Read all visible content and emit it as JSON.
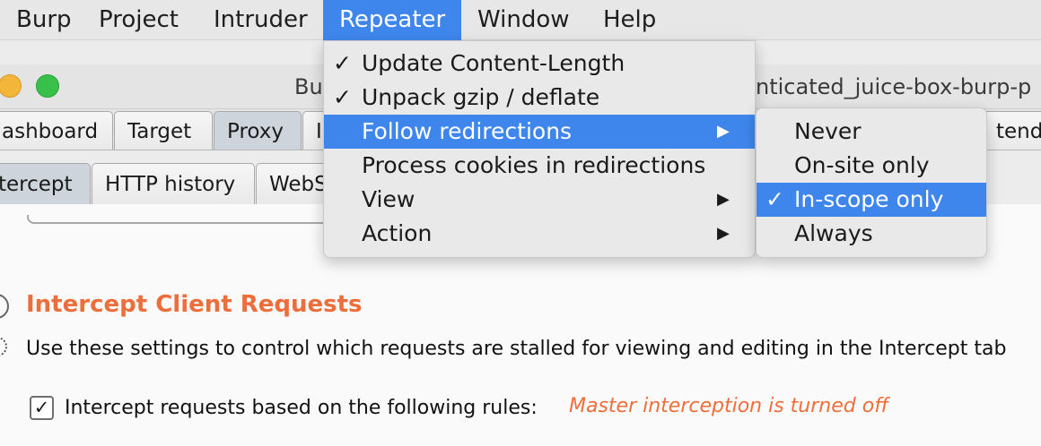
{
  "menubar": {
    "items": [
      "Burp",
      "Project",
      "Intruder",
      "Repeater",
      "Window",
      "Help"
    ],
    "active_index": 3
  },
  "window": {
    "title_left": "Bu",
    "title_right": "nticated_juice-box-burp-p"
  },
  "tabs": {
    "main": [
      "ashboard",
      "Target",
      "Proxy",
      "I",
      "tende"
    ],
    "selected_main": "Proxy",
    "sub": [
      "tercept",
      "HTTP history",
      "WebS"
    ]
  },
  "repeater_menu": {
    "items": [
      {
        "label": "Update Content-Length",
        "checked": true,
        "submenu": false,
        "highlighted": false
      },
      {
        "label": "Unpack gzip / deflate",
        "checked": true,
        "submenu": false,
        "highlighted": false
      },
      {
        "label": "Follow redirections",
        "checked": false,
        "submenu": true,
        "highlighted": true
      },
      {
        "label": "Process cookies in redirections",
        "checked": false,
        "submenu": false,
        "highlighted": false
      },
      {
        "label": "View",
        "checked": false,
        "submenu": true,
        "highlighted": false
      },
      {
        "label": "Action",
        "checked": false,
        "submenu": true,
        "highlighted": false
      }
    ],
    "check_glyph": "✓",
    "arrow_glyph": "▶"
  },
  "redirect_submenu": {
    "items": [
      {
        "label": "Never",
        "checked": false,
        "highlighted": false
      },
      {
        "label": "On-site only",
        "checked": false,
        "highlighted": false
      },
      {
        "label": "In-scope only",
        "checked": true,
        "highlighted": true
      },
      {
        "label": "Always",
        "checked": false,
        "highlighted": false
      }
    ]
  },
  "settings": {
    "heading": "Intercept Client Requests",
    "description": "Use these settings to control which requests are stalled for viewing and editing in the Intercept tab",
    "rules_label": "Intercept requests based on the following rules:",
    "rules_checked": true,
    "checkbox_glyph": "✓",
    "warning": "Master interception is turned off"
  },
  "colors": {
    "accent": "#3f86ec",
    "heading": "#ee6e3b"
  }
}
